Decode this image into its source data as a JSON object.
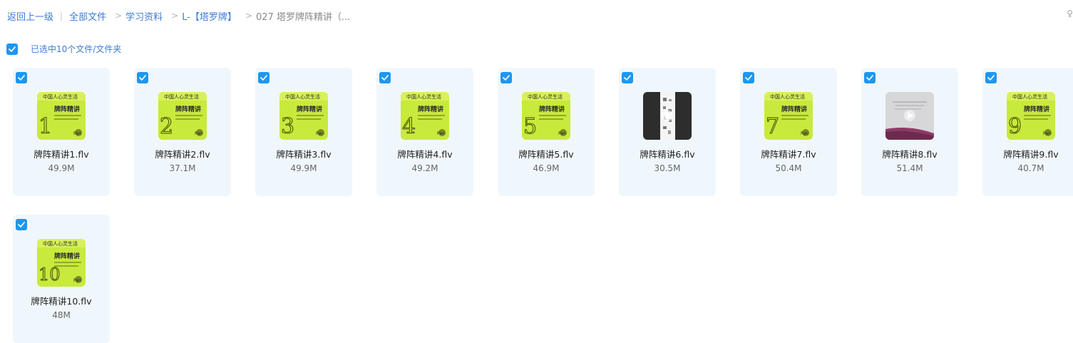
{
  "breadcrumb": {
    "back": "返回上一级",
    "sep": "|",
    "items": [
      "全部文件",
      "学习资料",
      "L-【塔罗牌】"
    ],
    "current": "027 塔罗牌阵精讲（..."
  },
  "corner_glyph": "♀",
  "selection": {
    "label": "已选中10个文件/文件夹",
    "checked": true
  },
  "thumb_text": {
    "banner": "中国人心灵生活",
    "title": "牌阵精讲",
    "logo": "Pan"
  },
  "files": [
    {
      "name": "牌阵精讲1.flv",
      "size": "49.9M",
      "thumb": "green",
      "number": "1"
    },
    {
      "name": "牌阵精讲2.flv",
      "size": "37.1M",
      "thumb": "green",
      "number": "2"
    },
    {
      "name": "牌阵精讲3.flv",
      "size": "49.9M",
      "thumb": "green",
      "number": "3"
    },
    {
      "name": "牌阵精讲4.flv",
      "size": "49.2M",
      "thumb": "green",
      "number": "4"
    },
    {
      "name": "牌阵精讲5.flv",
      "size": "46.9M",
      "thumb": "green",
      "number": "5"
    },
    {
      "name": "牌阵精讲6.flv",
      "size": "30.5M",
      "thumb": "dark",
      "number": ""
    },
    {
      "name": "牌阵精讲7.flv",
      "size": "50.4M",
      "thumb": "green",
      "number": "7"
    },
    {
      "name": "牌阵精讲8.flv",
      "size": "51.4M",
      "thumb": "gray",
      "number": ""
    },
    {
      "name": "牌阵精讲9.flv",
      "size": "40.7M",
      "thumb": "green",
      "number": "9"
    },
    {
      "name": "牌阵精讲10.flv",
      "size": "48M",
      "thumb": "green",
      "number": "10"
    }
  ],
  "colors": {
    "accent": "#1d97f0",
    "link": "#3d7bd6",
    "card_bg": "#f0f7fc",
    "thumb_green": "#c8ea3c",
    "thumb_dark": "#2d2d2d",
    "thumb_gray": "#d7d7d9"
  },
  "icons": {
    "checkbox": "checkmark-icon",
    "corner": "corner-icon",
    "play": "play-icon"
  }
}
